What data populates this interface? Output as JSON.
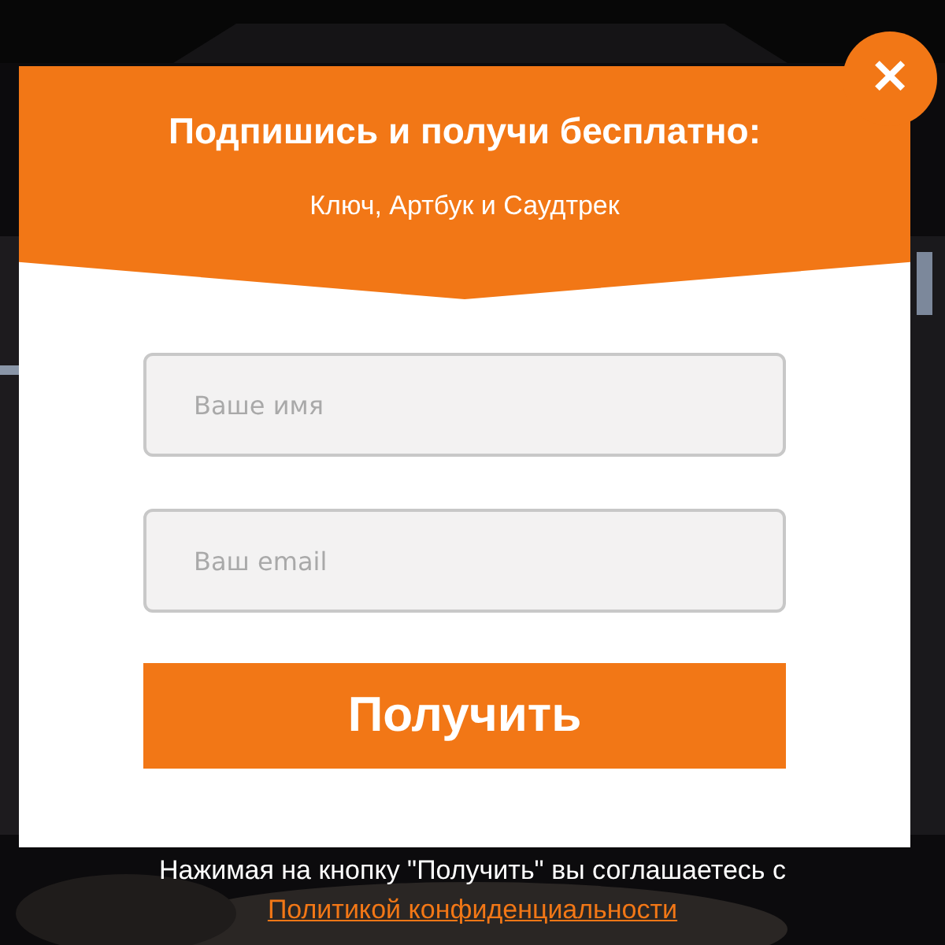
{
  "popup": {
    "title": "Подпишись и получи бесплатно:",
    "subtitle": "Ключ, Артбук и Саудтрек",
    "close": "✕",
    "fields": [
      {
        "placeholder": "Ваше имя"
      },
      {
        "placeholder": "Ваш email"
      }
    ],
    "submit": "Получить",
    "consent": {
      "text": "Нажимая на кнопку \"Получить\" вы соглашаетесь с",
      "link": "Политикой конфиденциальности"
    }
  }
}
